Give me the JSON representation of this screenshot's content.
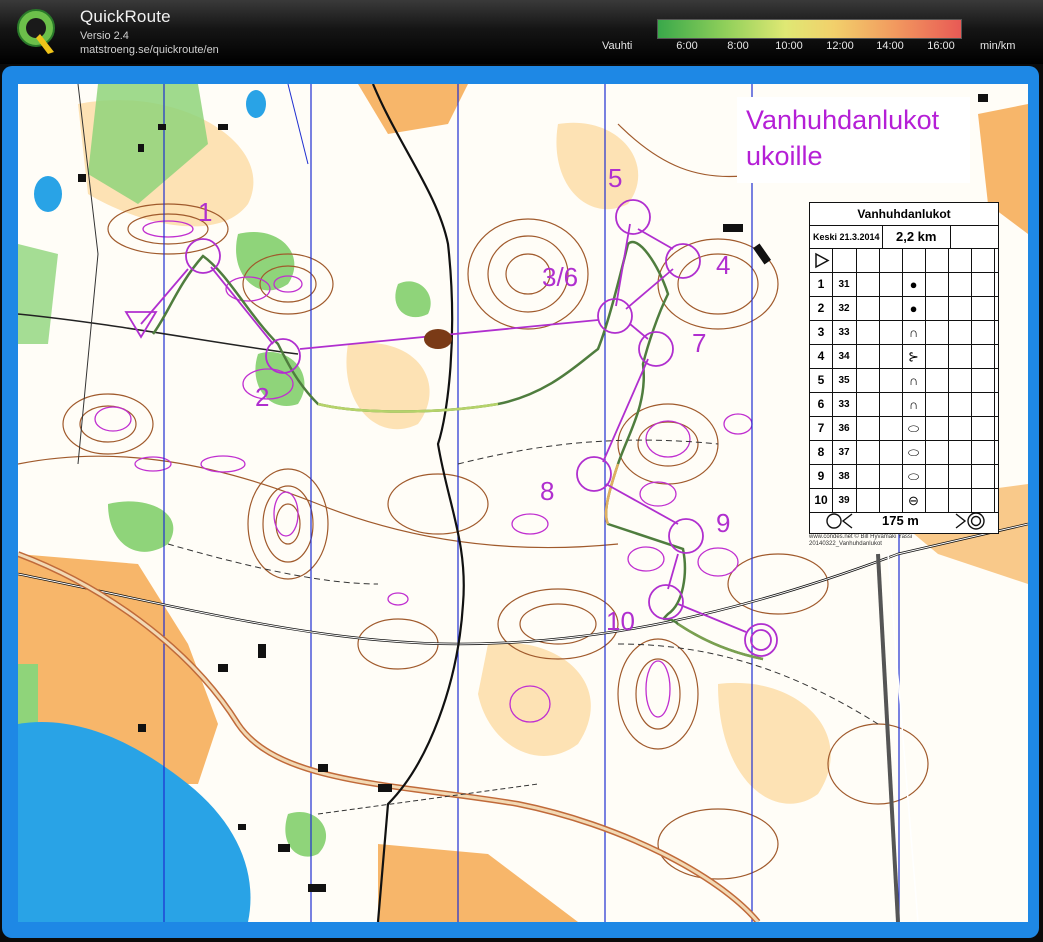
{
  "app": {
    "title": "QuickRoute",
    "version": "Versio 2.4",
    "url": "matstroeng.se/quickroute/en",
    "logo_icon": "quickroute-q-logo"
  },
  "pace_scale": {
    "label": "Vauhti",
    "ticks": [
      "6:00",
      "8:00",
      "10:00",
      "12:00",
      "14:00",
      "16:00"
    ],
    "unit": "min/km",
    "colors": [
      "#39a84a",
      "#8fcf5a",
      "#dfe874",
      "#f2d06b",
      "#f29a5f",
      "#e85a55"
    ]
  },
  "map": {
    "title_line1": "Vanhuhdanlukot",
    "title_line2": "ukoille",
    "course_color": "#b02fcf",
    "route_color": "#4f7d3e",
    "north_line_color": "#1f2fd0",
    "controls": [
      {
        "label": "1"
      },
      {
        "label": "2"
      },
      {
        "label": "3/6"
      },
      {
        "label": "4"
      },
      {
        "label": "5"
      },
      {
        "label": "7"
      },
      {
        "label": "8"
      },
      {
        "label": "9"
      },
      {
        "label": "10"
      }
    ]
  },
  "control_descriptions": {
    "title": "Vanhuhdanlukot",
    "course": "Keski 21.3.2014",
    "length": "2,2 km",
    "start_symbol": "start-triangle-icon",
    "rows": [
      {
        "num": "1",
        "code": "31",
        "symbol": "●",
        "symbol_icon": "knoll-dot-icon"
      },
      {
        "num": "2",
        "code": "32",
        "symbol": "●",
        "symbol_icon": "knoll-dot-icon"
      },
      {
        "num": "3",
        "code": "33",
        "symbol": "∩",
        "symbol_icon": "spur-icon"
      },
      {
        "num": "4",
        "code": "34",
        "symbol": "⊱",
        "symbol_icon": "re-entrant-icon"
      },
      {
        "num": "5",
        "code": "35",
        "symbol": "∩",
        "symbol_icon": "spur-icon"
      },
      {
        "num": "6",
        "code": "33",
        "symbol": "∩",
        "symbol_icon": "spur-icon"
      },
      {
        "num": "7",
        "code": "36",
        "symbol": "⬭",
        "symbol_icon": "hill-icon"
      },
      {
        "num": "8",
        "code": "37",
        "symbol": "⬭",
        "symbol_icon": "hill-icon"
      },
      {
        "num": "9",
        "code": "38",
        "symbol": "⬭",
        "symbol_icon": "hill-icon"
      },
      {
        "num": "10",
        "code": "39",
        "symbol": "⊖",
        "symbol_icon": "small-hill-icon"
      }
    ],
    "finish_distance": "175 m"
  },
  "credit": {
    "line1": "www.condes.net © Bill Hyvämäki Yassi",
    "line2": "20140322_Vanhuhdanlukot"
  }
}
